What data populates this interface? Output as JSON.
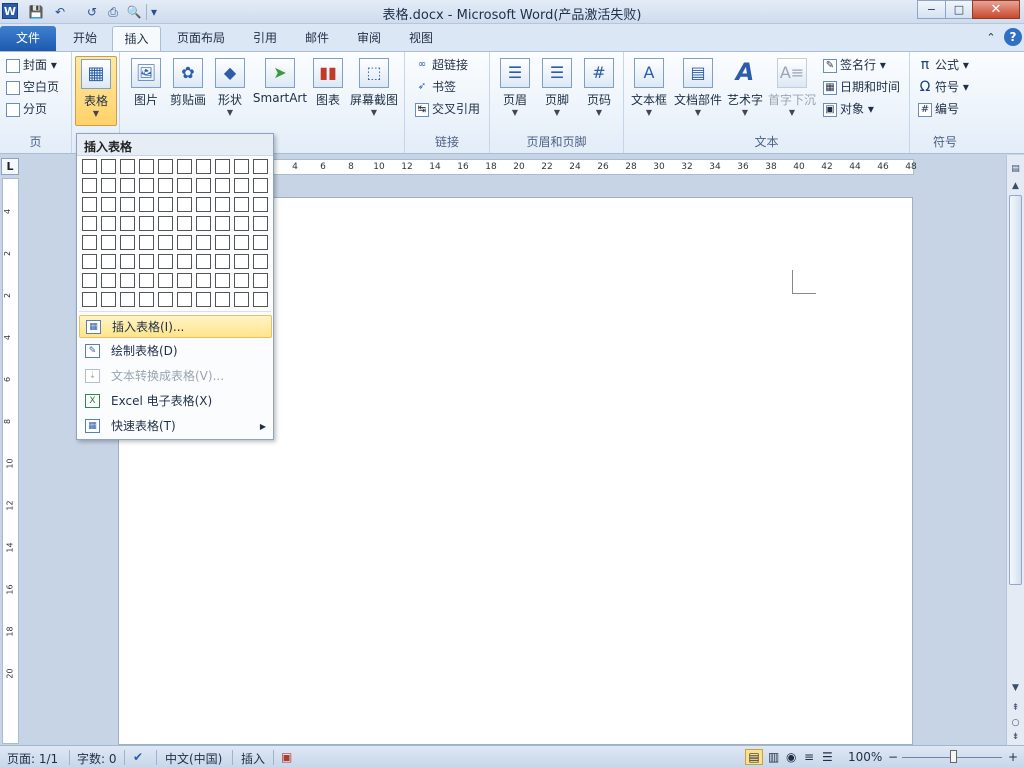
{
  "window": {
    "title": "表格.docx - Microsoft Word(产品激活失败)",
    "minimize": "−",
    "maximize": "□",
    "close": "✕"
  },
  "qat": {
    "save": "💾",
    "undo": "↶",
    "redo": "↺",
    "print": "⎙",
    "preview": "🔍",
    "customize": "▾"
  },
  "tabs": {
    "file": "文件",
    "items": [
      "开始",
      "插入",
      "页面布局",
      "引用",
      "邮件",
      "审阅",
      "视图"
    ],
    "active": "插入",
    "help_up": "⌃",
    "help": "?"
  },
  "ribbon": {
    "groups": {
      "pages": "页",
      "tables": "表格",
      "links": "链接",
      "header_footer": "页眉和页脚",
      "text": "文本",
      "symbols": "符号"
    },
    "pages": {
      "cover": "封面",
      "blank": "空白页",
      "break": "分页"
    },
    "table_btn": "表格",
    "illustrations": [
      "图片",
      "剪贴画",
      "形状",
      "SmartArt",
      "图表",
      "屏幕截图"
    ],
    "links": {
      "hyperlink": "超链接",
      "bookmark": "书签",
      "crossref": "交叉引用"
    },
    "header_footer": [
      "页眉",
      "页脚",
      "页码"
    ],
    "text": {
      "textbox": "文本框",
      "quickparts": "文档部件",
      "wordart": "艺术字",
      "dropcap": "首字下沉",
      "signature": "签名行",
      "datetime": "日期和时间",
      "object": "对象"
    },
    "symbols": {
      "equation": "公式",
      "symbol": "符号",
      "number": "编号"
    }
  },
  "dropdown": {
    "header": "插入表格",
    "grid": {
      "cols": 10,
      "rows": 8
    },
    "items": [
      {
        "label": "插入表格(I)...",
        "highlighted": true
      },
      {
        "label": "绘制表格(D)"
      },
      {
        "label": "文本转换成表格(V)...",
        "disabled": true
      },
      {
        "label": "Excel 电子表格(X)"
      },
      {
        "label": "快速表格(T)",
        "submenu": true
      }
    ]
  },
  "ruler": {
    "h_marks": [
      "4",
      "2",
      "2",
      "4",
      "6",
      "8",
      "10",
      "12",
      "14",
      "16",
      "18",
      "20",
      "22",
      "24",
      "26",
      "28",
      "30",
      "32",
      "34",
      "36",
      "38",
      "40",
      "42",
      "44",
      "46",
      "48"
    ],
    "v_marks": [
      "4",
      "2",
      "2",
      "4",
      "6",
      "8",
      "10",
      "12",
      "14",
      "16",
      "18",
      "20"
    ],
    "tab_selector": "L"
  },
  "status": {
    "page": "页面: 1/1",
    "words": "字数: 0",
    "lang": "中文(中国)",
    "mode": "插入",
    "zoom": "100%",
    "zoom_out": "−",
    "zoom_in": "+"
  }
}
